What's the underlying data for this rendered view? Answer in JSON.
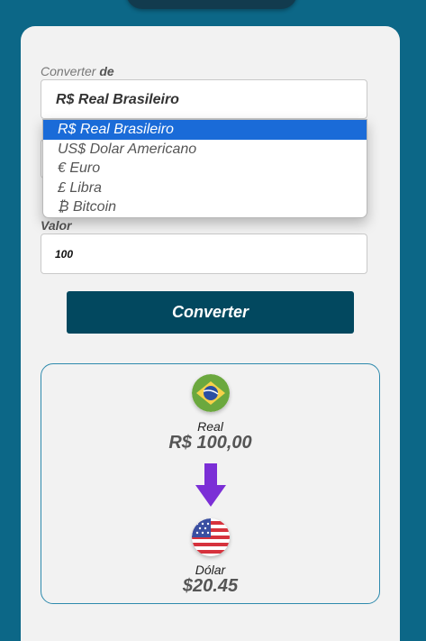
{
  "form": {
    "from_label_prefix": "Converter",
    "from_label_bold": "de",
    "from_selected": "R$ Real Brasileiro",
    "options": [
      "R$ Real Brasileiro",
      "US$ Dolar Americano",
      "€ Euro",
      "£ Libra",
      "₿ Bitcoin"
    ],
    "value_label": "Valor",
    "value": "100",
    "convert_button": "Converter"
  },
  "result": {
    "from_currency_name": "Real",
    "from_currency_value": "R$ 100,00",
    "to_currency_name": "Dólar",
    "to_currency_value": "$20.45",
    "from_flag_icon": "brazil-flag-icon",
    "to_flag_icon": "usa-flag-icon",
    "arrow_icon": "arrow-down-icon",
    "arrow_color": "#7b2fd6"
  },
  "colors": {
    "background": "#0c6787",
    "button": "#02485f",
    "highlight": "#1a6bd8"
  }
}
